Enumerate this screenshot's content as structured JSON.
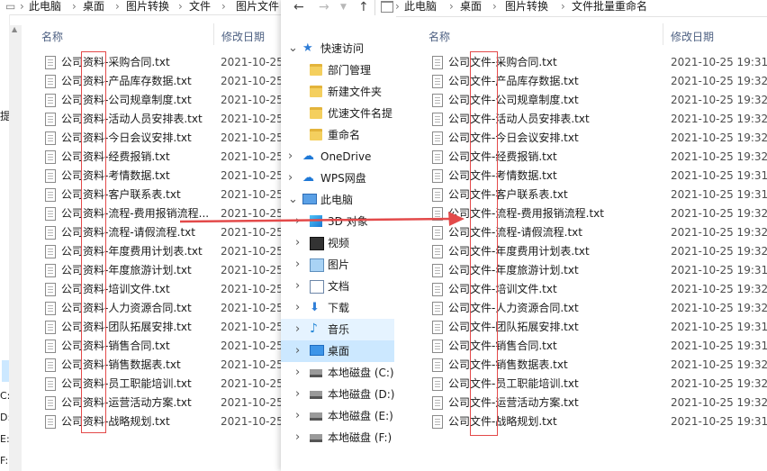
{
  "left_window": {
    "breadcrumb": [
      "此电脑",
      "桌面",
      "图片转换",
      "文件",
      "图片文件"
    ],
    "side_fragment": "提",
    "columns": {
      "name": "名称",
      "date": "修改日期"
    },
    "files": [
      {
        "name": "公司资料-采购合同.txt",
        "date": "2021-10-25"
      },
      {
        "name": "公司资料-产品库存数据.txt",
        "date": "2021-10-25"
      },
      {
        "name": "公司资料-公司规章制度.txt",
        "date": "2021-10-25"
      },
      {
        "name": "公司资料-活动人员安排表.txt",
        "date": "2021-10-25"
      },
      {
        "name": "公司资料-今日会议安排.txt",
        "date": "2021-10-25"
      },
      {
        "name": "公司资料-经费报销.txt",
        "date": "2021-10-25"
      },
      {
        "name": "公司资料-考情数据.txt",
        "date": "2021-10-25"
      },
      {
        "name": "公司资料-客户联系表.txt",
        "date": "2021-10-25"
      },
      {
        "name": "公司资料-流程-费用报销流程...",
        "date": "2021-10-25"
      },
      {
        "name": "公司资料-流程-请假流程.txt",
        "date": "2021-10-25"
      },
      {
        "name": "公司资料-年度费用计划表.txt",
        "date": "2021-10-25"
      },
      {
        "name": "公司资料-年度旅游计划.txt",
        "date": "2021-10-25"
      },
      {
        "name": "公司资料-培训文件.txt",
        "date": "2021-10-25"
      },
      {
        "name": "公司资料-人力资源合同.txt",
        "date": "2021-10-25"
      },
      {
        "name": "公司资料-团队拓展安排.txt",
        "date": "2021-10-25"
      },
      {
        "name": "公司资料-销售合同.txt",
        "date": "2021-10-25"
      },
      {
        "name": "公司资料-销售数据表.txt",
        "date": "2021-10-25"
      },
      {
        "name": "公司资料-员工职能培训.txt",
        "date": "2021-10-25"
      },
      {
        "name": "公司资料-运营活动方案.txt",
        "date": "2021-10-25"
      },
      {
        "name": "公司资料-战略规划.txt",
        "date": "2021-10-25"
      }
    ],
    "drive_fragments": [
      "C:)",
      "D:)",
      "E:)",
      "F:)"
    ]
  },
  "right_window": {
    "nav_buttons": {
      "back": "←",
      "forward": "→",
      "up": "↑"
    },
    "breadcrumb": [
      "此电脑",
      "桌面",
      "图片转换",
      "文件批量重命名"
    ],
    "nav": [
      {
        "label": "快速访问",
        "icon": "star-icon",
        "level": 0,
        "chevron": "v"
      },
      {
        "label": "部门管理",
        "icon": "folder-icon",
        "level": 1,
        "chevron": ""
      },
      {
        "label": "新建文件夹",
        "icon": "folder-icon",
        "level": 1,
        "chevron": ""
      },
      {
        "label": "优速文件名提",
        "icon": "folder-icon",
        "level": 1,
        "chevron": ""
      },
      {
        "label": "重命名",
        "icon": "folder-icon",
        "level": 1,
        "chevron": ""
      },
      {
        "label": "OneDrive",
        "icon": "cloud-icon",
        "level": 0,
        "chevron": ">"
      },
      {
        "label": "WPS网盘",
        "icon": "cloud-icon",
        "level": 0,
        "chevron": ">"
      },
      {
        "label": "此电脑",
        "icon": "computer-icon",
        "level": 0,
        "chevron": "v"
      },
      {
        "label": "3D 对象",
        "icon": "cube-icon",
        "level": 1,
        "chevron": ">"
      },
      {
        "label": "视频",
        "icon": "video-icon",
        "level": 1,
        "chevron": ">"
      },
      {
        "label": "图片",
        "icon": "picture-icon",
        "level": 1,
        "chevron": ">"
      },
      {
        "label": "文档",
        "icon": "document-icon",
        "level": 1,
        "chevron": ">"
      },
      {
        "label": "下载",
        "icon": "download-icon",
        "level": 1,
        "chevron": ">"
      },
      {
        "label": "音乐",
        "icon": "music-icon",
        "level": 1,
        "chevron": ">"
      },
      {
        "label": "桌面",
        "icon": "desktop-icon",
        "level": 1,
        "chevron": ">"
      },
      {
        "label": "本地磁盘 (C:)",
        "icon": "drive-icon",
        "level": 1,
        "chevron": ">"
      },
      {
        "label": "本地磁盘 (D:)",
        "icon": "drive-icon",
        "level": 1,
        "chevron": ">"
      },
      {
        "label": "本地磁盘 (E:)",
        "icon": "drive-icon",
        "level": 1,
        "chevron": ">"
      },
      {
        "label": "本地磁盘 (F:)",
        "icon": "drive-icon",
        "level": 1,
        "chevron": ">"
      }
    ],
    "columns": {
      "name": "名称",
      "date": "修改日期"
    },
    "files": [
      {
        "name": "公司文件-采购合同.txt",
        "date": "2021-10-25 19:31"
      },
      {
        "name": "公司文件-产品库存数据.txt",
        "date": "2021-10-25 19:32"
      },
      {
        "name": "公司文件-公司规章制度.txt",
        "date": "2021-10-25 19:32"
      },
      {
        "name": "公司文件-活动人员安排表.txt",
        "date": "2021-10-25 19:32"
      },
      {
        "name": "公司文件-今日会议安排.txt",
        "date": "2021-10-25 19:32"
      },
      {
        "name": "公司文件-经费报销.txt",
        "date": "2021-10-25 19:32"
      },
      {
        "name": "公司文件-考情数据.txt",
        "date": "2021-10-25 19:31"
      },
      {
        "name": "公司文件-客户联系表.txt",
        "date": "2021-10-25 19:31"
      },
      {
        "name": "公司文件-流程-费用报销流程.txt",
        "date": "2021-10-25 19:32"
      },
      {
        "name": "公司文件-流程-请假流程.txt",
        "date": "2021-10-25 19:32"
      },
      {
        "name": "公司文件-年度费用计划表.txt",
        "date": "2021-10-25 19:32"
      },
      {
        "name": "公司文件-年度旅游计划.txt",
        "date": "2021-10-25 19:31"
      },
      {
        "name": "公司文件-培训文件.txt",
        "date": "2021-10-25 19:32"
      },
      {
        "name": "公司文件-人力资源合同.txt",
        "date": "2021-10-25 19:32"
      },
      {
        "name": "公司文件-团队拓展安排.txt",
        "date": "2021-10-25 19:31"
      },
      {
        "name": "公司文件-销售合同.txt",
        "date": "2021-10-25 19:31"
      },
      {
        "name": "公司文件-销售数据表.txt",
        "date": "2021-10-25 19:32"
      },
      {
        "name": "公司文件-员工职能培训.txt",
        "date": "2021-10-25 19:32"
      },
      {
        "name": "公司文件-运营活动方案.txt",
        "date": "2021-10-25 19:32"
      },
      {
        "name": "公司文件-战略规划.txt",
        "date": "2021-10-25 19:31"
      }
    ]
  },
  "colors": {
    "highlight": "#e34a4a",
    "nav_hover": "#e5f3ff",
    "nav_selected": "#cce8ff",
    "folder": "#f4cf5e"
  }
}
